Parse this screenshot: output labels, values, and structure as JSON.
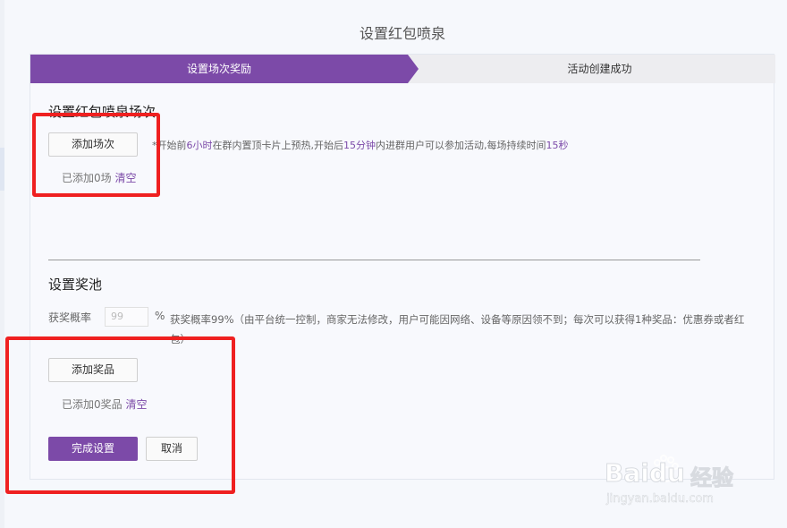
{
  "page": {
    "title": "设置红包喷泉"
  },
  "steps": {
    "active_label": "设置场次奖励",
    "next_label": "活动创建成功"
  },
  "session_section": {
    "title": "设置红包喷泉场次",
    "add_button": "添加场次",
    "hint_parts": [
      "*开始前",
      "6小时",
      "在群内置顶卡片上预热,开始后",
      "15分钟",
      "内进群用户可以参加活动,每场持续时间",
      "15秒"
    ],
    "added_text": "已添加0场",
    "clear_label": "清空"
  },
  "prize_section": {
    "title": "设置奖池",
    "prob_label": "获奖概率",
    "prob_value": "99",
    "percent": "%",
    "prob_desc": "获奖概率99%（由平台统一控制，商家无法修改，用户可能因网络、设备等原因领不到；每次可以获得1种奖品：优惠券或者红包）",
    "add_button": "添加奖品",
    "added_text": "已添加0奖品",
    "clear_label": "清空"
  },
  "actions": {
    "confirm": "完成设置",
    "cancel": "取消"
  },
  "watermark": {
    "brand": "Baidu",
    "cn": "经验",
    "url": "jingyan.baidu.com"
  },
  "colors": {
    "accent": "#7c4aa8",
    "highlight_red": "#ef2020"
  }
}
